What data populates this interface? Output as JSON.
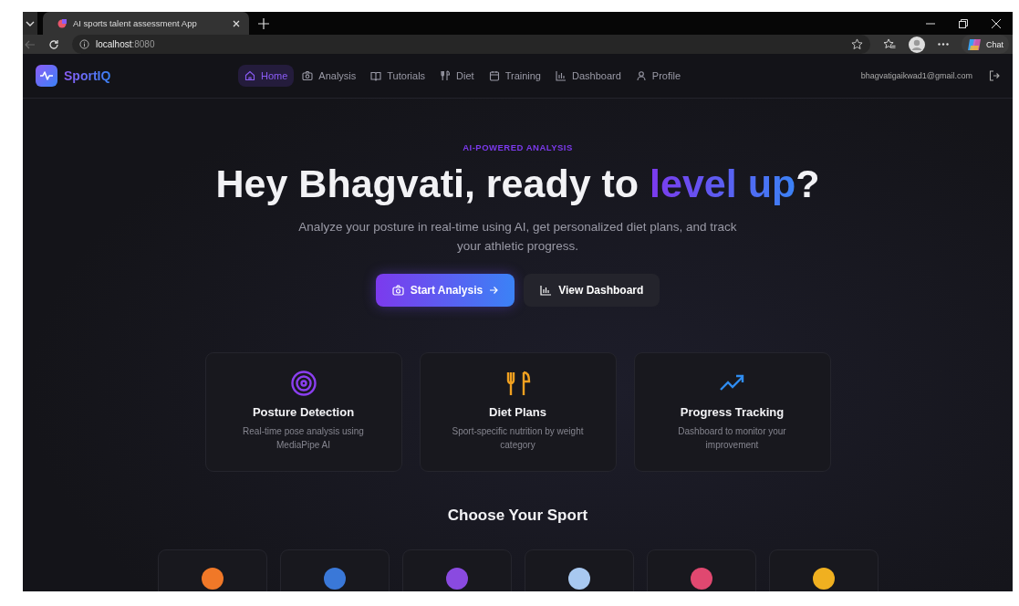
{
  "browser": {
    "tabs": [
      {
        "title": "AI sports talent assessment App",
        "selected": true
      }
    ],
    "address": {
      "host": "localhost",
      "port": ":8080"
    },
    "chat": "Chat"
  },
  "app": {
    "brand": "SportIQ",
    "nav": [
      {
        "label": "Home",
        "selected": true
      },
      {
        "label": "Analysis",
        "selected": false
      },
      {
        "label": "Tutorials",
        "selected": false
      },
      {
        "label": "Diet",
        "selected": false
      },
      {
        "label": "Training",
        "selected": false
      },
      {
        "label": "Dashboard",
        "selected": false
      },
      {
        "label": "Profile",
        "selected": false
      }
    ],
    "user_email": "bhagvatigaikwad1@gmail.com"
  },
  "hero": {
    "eyebrow": "AI-POWERED ANALYSIS",
    "title": [
      {
        "text": "Hey Bhagvati, ready to ",
        "highlight": false
      },
      {
        "text": "level up",
        "highlight": true
      },
      {
        "text": "?",
        "highlight": false
      }
    ],
    "subtitle": "Analyze your posture in real-time using AI, get personalized diet plans, and track your athletic progress.",
    "buttons": [
      {
        "label": "Start Analysis",
        "kind": "primary"
      },
      {
        "label": "View Dashboard",
        "kind": "secondary"
      }
    ]
  },
  "features": [
    {
      "title": "Posture Detection",
      "text": "Real-time pose analysis using MediaPipe AI",
      "color": "#8b3ff0"
    },
    {
      "title": "Diet Plans",
      "text": "Sport-specific nutrition by weight category",
      "color": "#f0a020"
    },
    {
      "title": "Progress Tracking",
      "text": "Dashboard to monitor your improvement",
      "color": "#2f8cf0"
    }
  ],
  "sports": {
    "heading": "Choose Your Sport",
    "cards": [
      {
        "color": "#f07828"
      },
      {
        "color": "#3a78d8"
      },
      {
        "color": "#8a4ae0"
      },
      {
        "color": "#a8c8f0"
      },
      {
        "color": "#e04870"
      },
      {
        "color": "#f0b020"
      }
    ]
  }
}
